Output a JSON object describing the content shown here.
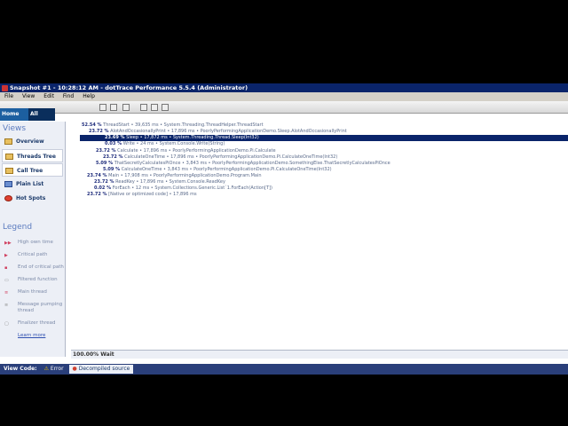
{
  "window": {
    "title": "Snapshot #1 - 10:28:12 AM - dotTrace Performance 5.5.4 (Administrator)"
  },
  "menu": [
    "File",
    "View",
    "Edit",
    "Find",
    "Help"
  ],
  "tabs": {
    "home": "Home",
    "all_calls": "All Calls"
  },
  "sidebar": {
    "views_heading": "Views",
    "views": [
      "Overview",
      "Threads Tree",
      "Call Tree",
      "Plain List",
      "Hot Spots"
    ],
    "legend_heading": "Legend",
    "legend": [
      "High own time",
      "Critical path",
      "End of critical path",
      "Filtered function",
      "Main thread",
      "Message pumping thread",
      "Finalizer thread"
    ],
    "learn_more": "Learn more"
  },
  "tree": [
    {
      "pct": "52.54 %",
      "text": "ThreadStart • 39,635 ms • System.Threading.ThreadHelper.ThreadStart"
    },
    {
      "pct": "23.72 %",
      "text": "AlotAndOccasionallyPrint • 17,896 ms • PoorlyPerformingApplicationDemo.Sleep.AlotAndOccasionallyPrint"
    },
    {
      "pct": "23.69 %",
      "text": "Sleep • 17,872 ms • System.Threading.Thread.Sleep(Int32)"
    },
    {
      "pct": "0.03 %",
      "text": "Write • 24 ms • System.Console.Write(String)"
    },
    {
      "pct": "23.72 %",
      "text": "Calculate • 17,896 ms • PoorlyPerformingApplicationDemo.Pi.Calculate"
    },
    {
      "pct": "23.72 %",
      "text": "CalculateOneTime • 17,896 ms • PoorlyPerformingApplicationDemo.Pi.CalculateOneTime(Int32)"
    },
    {
      "pct": "5.09 %",
      "text": "ThatSecretlyCalculatesPiOnce • 3,843 ms • PoorlyPerformingApplicationDemo.SomethingElse.ThatSecretlyCalculatesPiOnce"
    },
    {
      "pct": "5.09 %",
      "text": "CalculateOneTime • 3,843 ms • PoorlyPerformingApplicationDemo.Pi.CalculateOneTime(Int32)"
    },
    {
      "pct": "23.74 %",
      "text": "Main • 17,908 ms • PoorlyPerformingApplicationDemo.Program.Main"
    },
    {
      "pct": "23.72 %",
      "text": "ReadKey • 17,896 ms • System.Console.ReadKey"
    },
    {
      "pct": "0.02 %",
      "text": "ForEach • 12 ms • System.Collections.Generic.List`1.ForEach(Action[T])"
    },
    {
      "pct": "23.72 %",
      "text": "[Native or optimized code] • 17,896 ms"
    }
  ],
  "status": "100.00% Wait",
  "bottom": {
    "label": "View Code:",
    "error": "Error",
    "decompiled": "Decompiled source"
  }
}
